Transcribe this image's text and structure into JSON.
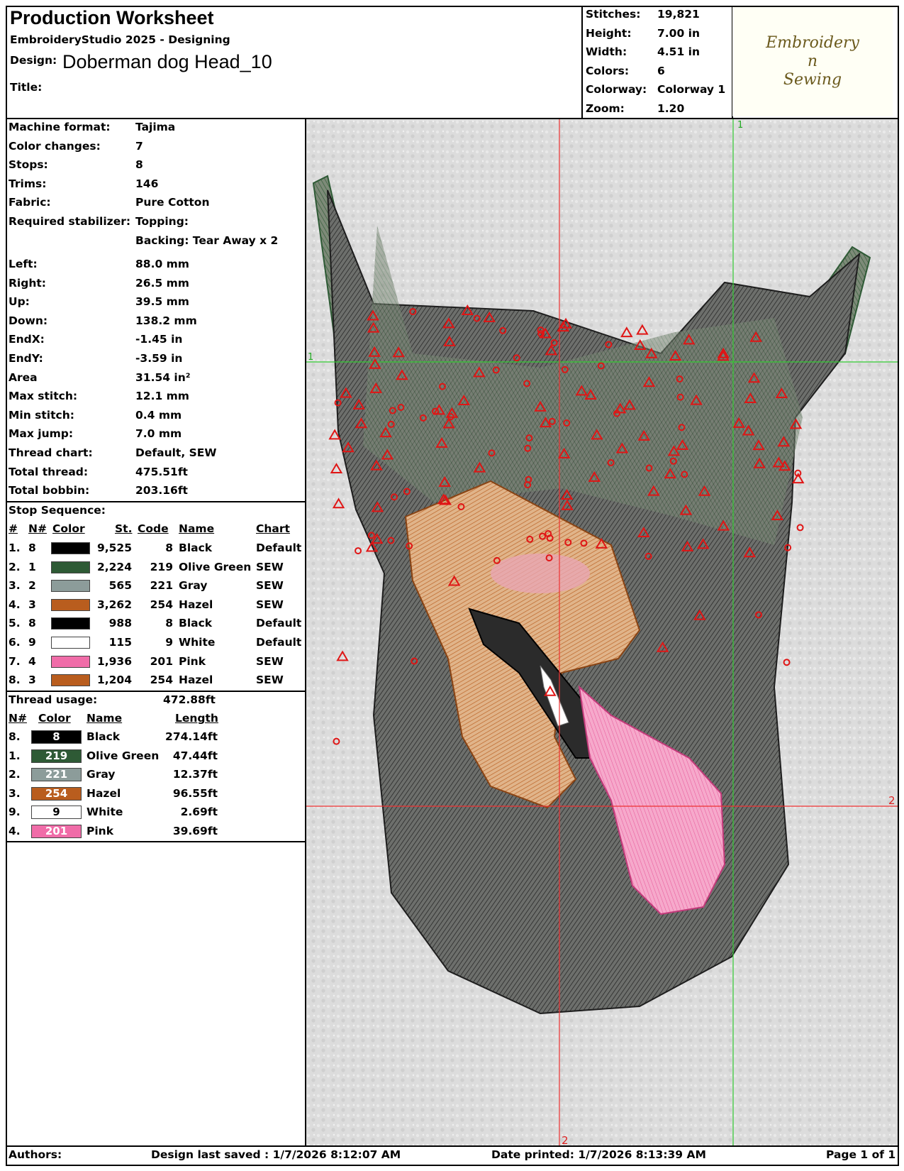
{
  "header": {
    "title": "Production Worksheet",
    "software": "EmbroideryStudio 2025 - Designing",
    "design_label": "Design:",
    "design_value": "Doberman dog Head_10",
    "title_label": "Title:"
  },
  "stats": [
    {
      "label": "Stitches:",
      "value": "19,821"
    },
    {
      "label": "Height:",
      "value": "7.00 in"
    },
    {
      "label": "Width:",
      "value": "4.51 in"
    },
    {
      "label": "Colors:",
      "value": "6"
    },
    {
      "label": "Colorway:",
      "value": "Colorway 1"
    },
    {
      "label": "Zoom:",
      "value": "1.20"
    }
  ],
  "logo": {
    "line1": "Embroidery",
    "line2": "n",
    "line3": "Sewing"
  },
  "machine_info": [
    {
      "label": "Machine format:",
      "value": "Tajima"
    },
    {
      "label": "Color changes:",
      "value": "7"
    },
    {
      "label": "Stops:",
      "value": "8"
    },
    {
      "label": "Trims:",
      "value": "146"
    },
    {
      "label": "Fabric:",
      "value": "Pure Cotton"
    },
    {
      "label": "Required stabilizer:",
      "value": "Topping:"
    },
    {
      "label": "",
      "value": "Backing: Tear Away x 2"
    }
  ],
  "dimensions": [
    {
      "label": "Left:",
      "value": "88.0 mm"
    },
    {
      "label": "Right:",
      "value": "26.5 mm"
    },
    {
      "label": "Up:",
      "value": "39.5 mm"
    },
    {
      "label": "Down:",
      "value": "138.2 mm"
    },
    {
      "label": "EndX:",
      "value": "-1.45 in"
    },
    {
      "label": "EndY:",
      "value": "-3.59 in"
    },
    {
      "label": "Area",
      "value": " 31.54 in²"
    },
    {
      "label": "Max stitch:",
      "value": "12.1 mm"
    },
    {
      "label": "Min stitch:",
      "value": "0.4 mm"
    },
    {
      "label": "Max jump:",
      "value": "7.0 mm"
    },
    {
      "label": "Thread chart:",
      "value": "Default, SEW"
    },
    {
      "label": "Total thread:",
      "value": "475.51ft"
    },
    {
      "label": "Total bobbin:",
      "value": "203.16ft"
    }
  ],
  "stop_sequence": {
    "title": "Stop Sequence:",
    "headers": [
      "#",
      "N#",
      "Color",
      "St.",
      "Code",
      "Name",
      "Chart"
    ],
    "rows": [
      {
        "num": "1.",
        "n": "8",
        "color": "#000000",
        "st": "9,525",
        "code": "8",
        "name": "Black",
        "chart": "Default"
      },
      {
        "num": "2.",
        "n": "1",
        "color": "#2e5a35",
        "st": "2,224",
        "code": "219",
        "name": "Olive Green",
        "chart": "SEW"
      },
      {
        "num": "3.",
        "n": "2",
        "color": "#8c9c9a",
        "st": "565",
        "code": "221",
        "name": "Gray",
        "chart": "SEW"
      },
      {
        "num": "4.",
        "n": "3",
        "color": "#b95d1e",
        "st": "3,262",
        "code": "254",
        "name": "Hazel",
        "chart": "SEW"
      },
      {
        "num": "5.",
        "n": "8",
        "color": "#000000",
        "st": "988",
        "code": "8",
        "name": "Black",
        "chart": "Default"
      },
      {
        "num": "6.",
        "n": "9",
        "color": "#ffffff",
        "st": "115",
        "code": "9",
        "name": "White",
        "chart": "Default"
      },
      {
        "num": "7.",
        "n": "4",
        "color": "#f06ca8",
        "st": "1,936",
        "code": "201",
        "name": "Pink",
        "chart": "SEW"
      },
      {
        "num": "8.",
        "n": "3",
        "color": "#b95d1e",
        "st": "1,204",
        "code": "254",
        "name": "Hazel",
        "chart": "SEW"
      }
    ]
  },
  "thread_usage": {
    "title": "Thread usage:",
    "total": "472.88ft",
    "headers": [
      "N#",
      "Color",
      "Name",
      "Length"
    ],
    "rows": [
      {
        "n": "8.",
        "code": "8",
        "color": "#000000",
        "name": "Black",
        "length": "274.14ft"
      },
      {
        "n": "1.",
        "code": "219",
        "color": "#2e5a35",
        "name": "Olive Green",
        "length": "47.44ft"
      },
      {
        "n": "2.",
        "code": "221",
        "color": "#8c9c9a",
        "name": "Gray",
        "length": "12.37ft"
      },
      {
        "n": "3.",
        "code": "254",
        "color": "#b95d1e",
        "name": "Hazel",
        "length": "96.55ft"
      },
      {
        "n": "9.",
        "code": "9",
        "color": "#ffffff",
        "name": "White",
        "length": "2.69ft"
      },
      {
        "n": "4.",
        "code": "201",
        "color": "#f06ca8",
        "name": "Pink",
        "length": "39.69ft"
      }
    ]
  },
  "canvas": {
    "guide_label_1": "1",
    "guide_label_2": "2"
  },
  "footer": {
    "authors": "Authors:",
    "saved": "Design last saved : 1/7/2026 8:12:07 AM",
    "printed": "Date printed: 1/7/2026 8:13:39 AM",
    "page": "Page 1 of 1"
  }
}
